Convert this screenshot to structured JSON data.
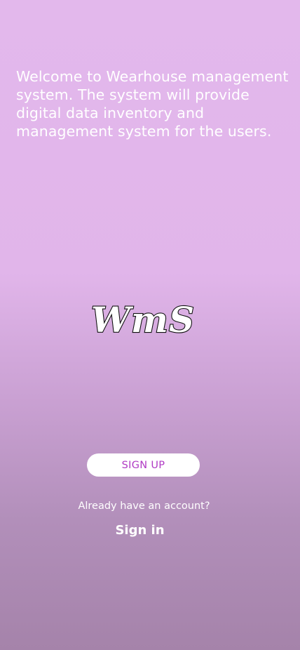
{
  "welcome_text": "Welcome to Wearhouse management system. The system will provide digital data inventory and management system for the users.",
  "logo": {
    "text": "WmS"
  },
  "signup_button_label": "SIGN UP",
  "already_account_text": "Already have an account?",
  "signin_label": "Sign in",
  "colors": {
    "background_top": "#e3b8ec",
    "background_bottom": "#a583aa",
    "signup_text": "#b03bc4",
    "signup_background": "#ffffff",
    "text": "#ffffff"
  }
}
